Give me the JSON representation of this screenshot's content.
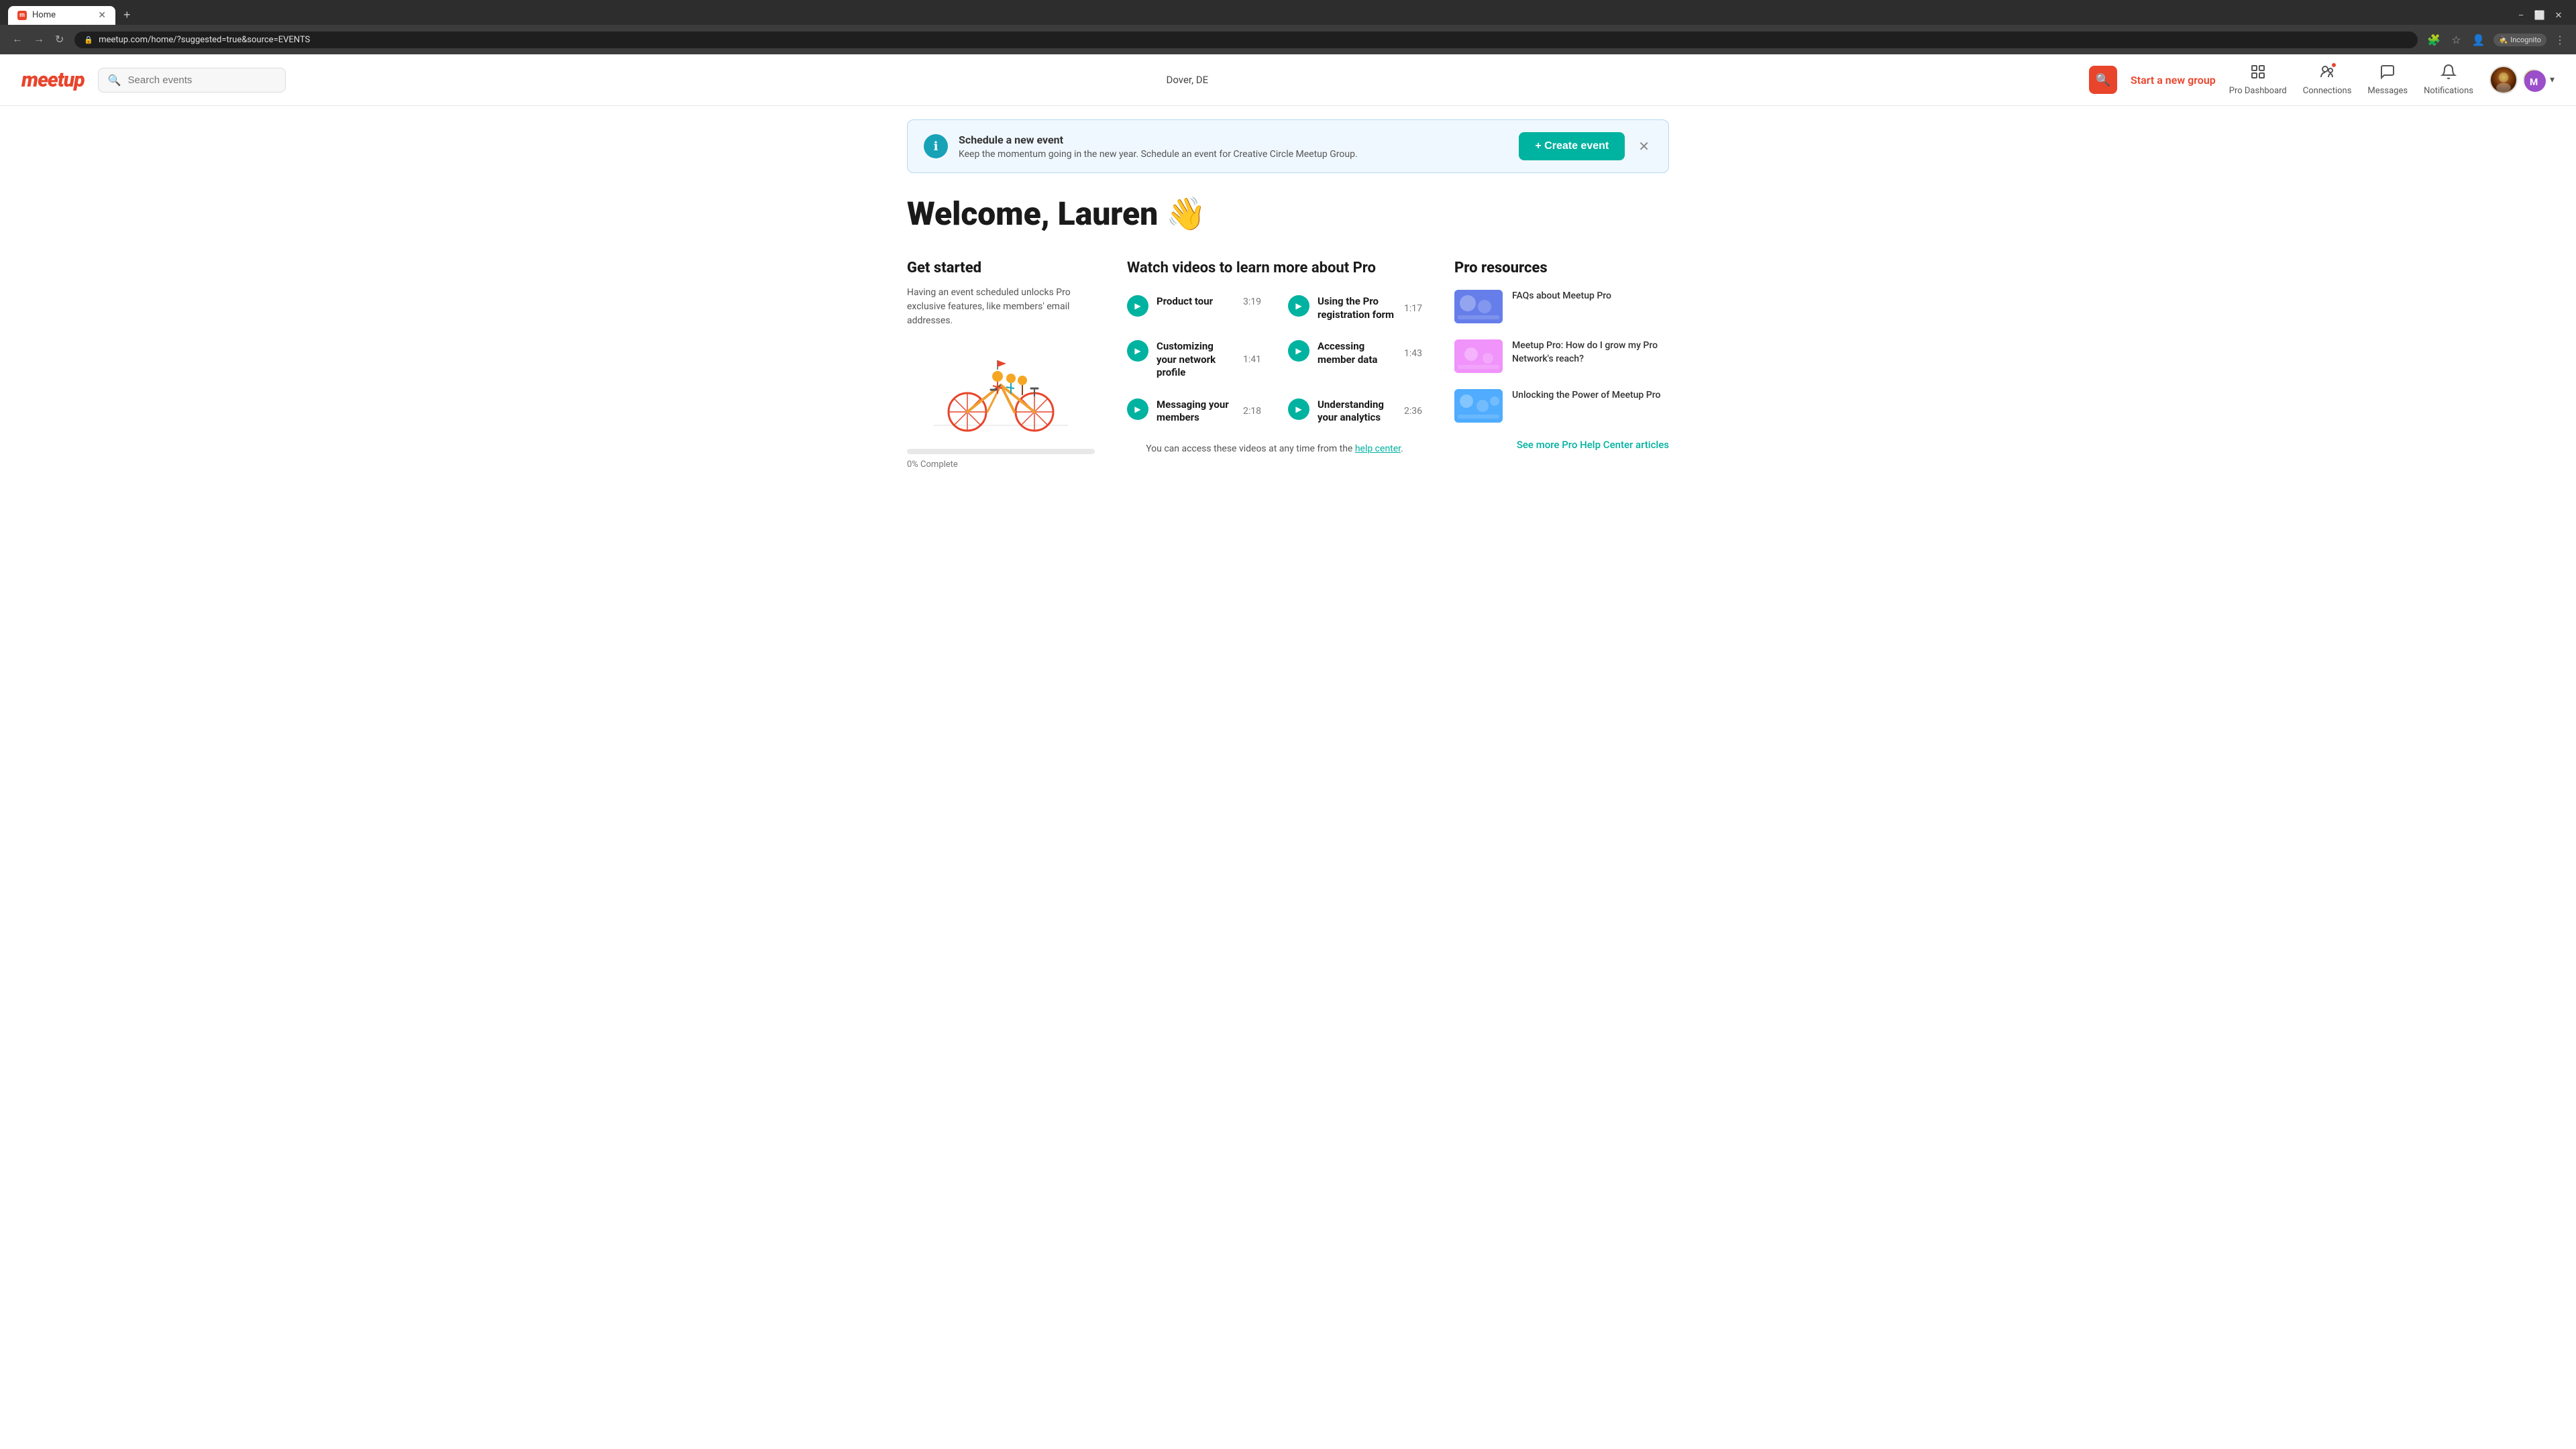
{
  "browser": {
    "tab_title": "Home",
    "url": "meetup.com/home/?suggested=true&source=EVENTS",
    "incognito_label": "Incognito"
  },
  "header": {
    "logo": "meetup",
    "search_placeholder": "Search events",
    "location": "Dover, DE",
    "search_btn_label": "🔍",
    "start_group": "Start a new group",
    "nav": {
      "pro_dashboard": "Pro Dashboard",
      "connections": "Connections",
      "messages": "Messages",
      "notifications": "Notifications"
    }
  },
  "banner": {
    "title": "Schedule a new event",
    "text": "Keep the momentum going in the new year. Schedule an event for Creative Circle Meetup Group.",
    "create_btn": "+ Create event"
  },
  "welcome": {
    "heading": "Welcome, Lauren",
    "emoji": "👋"
  },
  "get_started": {
    "title": "Get started",
    "description": "Having an event scheduled unlocks Pro exclusive features, like members' email addresses.",
    "progress_label": "0% Complete"
  },
  "videos": {
    "section_title": "Watch videos to learn more about Pro",
    "items": [
      {
        "title": "Product tour",
        "duration": "3:19"
      },
      {
        "title": "Using the Pro registration form",
        "duration": "1:17"
      },
      {
        "title": "Customizing your network profile",
        "duration": "1:41"
      },
      {
        "title": "Accessing member data",
        "duration": "1:43"
      },
      {
        "title": "Messaging your members",
        "duration": "2:18"
      },
      {
        "title": "Understanding your analytics",
        "duration": "2:36"
      }
    ],
    "help_text_pre": "You can access these videos at any time from the ",
    "help_link": "help center",
    "help_text_post": "."
  },
  "pro_resources": {
    "title": "Pro resources",
    "items": [
      {
        "text": "FAQs about Meetup Pro"
      },
      {
        "text": "Meetup Pro: How do I grow my Pro Network's reach?"
      },
      {
        "text": "Unlocking the Power of Meetup Pro"
      }
    ],
    "see_more": "See more Pro Help Center articles"
  }
}
